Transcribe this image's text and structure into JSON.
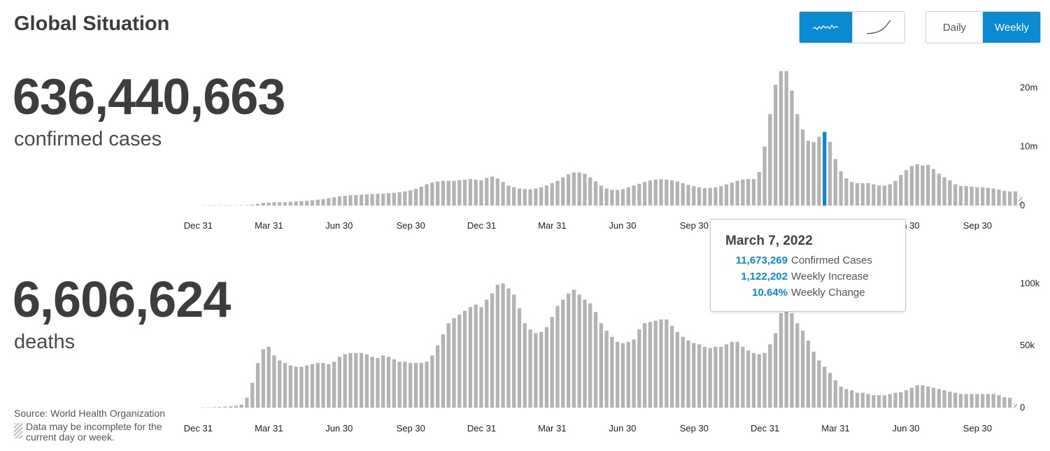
{
  "header": {
    "title": "Global Situation",
    "scale_buttons": [
      {
        "name": "linear-wave-icon",
        "active": true
      },
      {
        "name": "cumulative-curve-icon",
        "active": false
      }
    ],
    "period_buttons": [
      {
        "label": "Daily",
        "active": false
      },
      {
        "label": "Weekly",
        "active": true
      }
    ]
  },
  "cases": {
    "total": "636,440,663",
    "label": "confirmed cases"
  },
  "deaths": {
    "total": "6,606,624",
    "label": "deaths"
  },
  "tooltip": {
    "date": "March 7, 2022",
    "rows": [
      {
        "value": "11,673,269",
        "label": "Confirmed Cases"
      },
      {
        "value": "1,122,202",
        "label": "Weekly Increase"
      },
      {
        "value": "10.64%",
        "label": "Weekly Change"
      }
    ]
  },
  "footer": {
    "source": "Source: World Health Organization",
    "note": "Data may be incomplete for the current day or week."
  },
  "colors": {
    "bar": "#b3b3b3",
    "highlight": "#0a8ad3",
    "accent": "#0a8ad3",
    "text": "#444444"
  },
  "chart_data": [
    {
      "type": "bar",
      "title": "Weekly confirmed cases",
      "ylim": [
        0,
        23000000
      ],
      "y_ticks": [
        {
          "value": 0,
          "label": "0"
        },
        {
          "value": 10000000,
          "label": "10m"
        },
        {
          "value": 20000000,
          "label": "20m"
        }
      ],
      "x_ticks": [
        {
          "index": 1,
          "label": "Dec 31"
        },
        {
          "index": 14,
          "label": "Mar 31"
        },
        {
          "index": 27,
          "label": "Jun 30"
        },
        {
          "index": 40,
          "label": "Sep 30"
        },
        {
          "index": 53,
          "label": "Dec 31"
        },
        {
          "index": 66,
          "label": "Mar 31"
        },
        {
          "index": 79,
          "label": "Jun 30"
        },
        {
          "index": 92,
          "label": "Sep 30"
        },
        {
          "index": 105,
          "label": "Dec 31"
        },
        {
          "index": 118,
          "label": "Mar 31"
        },
        {
          "index": 131,
          "label": "Jun 30"
        },
        {
          "index": 144,
          "label": "Sep 30"
        }
      ],
      "highlight_index": 114,
      "incomplete_last": true,
      "values": [
        0,
        0,
        0,
        0,
        0,
        0,
        0,
        20000,
        70000,
        160000,
        300000,
        450000,
        500000,
        550000,
        570000,
        600000,
        650000,
        700000,
        750000,
        800000,
        900000,
        1000000,
        1100000,
        1250000,
        1400000,
        1550000,
        1650000,
        1750000,
        1800000,
        1850000,
        1900000,
        1950000,
        2000000,
        2050000,
        2100000,
        2150000,
        2250000,
        2400000,
        2600000,
        2850000,
        3200000,
        3600000,
        3900000,
        4100000,
        4200000,
        4200000,
        4200000,
        4300000,
        4400000,
        4500000,
        4400000,
        4300000,
        4700000,
        4900000,
        4600000,
        4000000,
        3400000,
        3100000,
        2900000,
        2800000,
        2750000,
        2900000,
        3100000,
        3400000,
        3800000,
        4200000,
        4800000,
        5300000,
        5600000,
        5600000,
        5400000,
        4800000,
        4100000,
        3400000,
        2900000,
        2650000,
        2650000,
        2800000,
        3100000,
        3400000,
        3700000,
        4000000,
        4250000,
        4400000,
        4450000,
        4400000,
        4300000,
        4100000,
        3800000,
        3500000,
        3300000,
        3100000,
        2950000,
        3000000,
        3100000,
        3300000,
        3600000,
        3900000,
        4200000,
        4400000,
        4500000,
        4500000,
        5700000,
        10000000,
        15500000,
        20500000,
        22800000,
        22800000,
        19500000,
        15500000,
        12900000,
        11000000,
        10800000,
        11673269,
        12500000,
        10800000,
        7900000,
        5800000,
        4600000,
        4000000,
        3800000,
        3800000,
        3800000,
        3600000,
        3400000,
        3400000,
        3600000,
        4200000,
        5200000,
        6000000,
        6700000,
        7000000,
        6800000,
        6900000,
        6200000,
        5400000,
        4800000,
        4300000,
        3600000,
        3300000,
        3300000,
        3200000,
        3100000,
        3100000,
        3000000,
        2900000,
        2700000,
        2500000,
        2400000,
        2400000,
        1600000
      ]
    },
    {
      "type": "bar",
      "title": "Weekly deaths",
      "ylim": [
        0,
        107000
      ],
      "y_ticks": [
        {
          "value": 0,
          "label": "0"
        },
        {
          "value": 50000,
          "label": "50k"
        },
        {
          "value": 100000,
          "label": "100k"
        }
      ],
      "x_ticks": [
        {
          "index": 1,
          "label": "Dec 31"
        },
        {
          "index": 14,
          "label": "Mar 31"
        },
        {
          "index": 27,
          "label": "Jun 30"
        },
        {
          "index": 40,
          "label": "Sep 30"
        },
        {
          "index": 53,
          "label": "Dec 31"
        },
        {
          "index": 66,
          "label": "Mar 31"
        },
        {
          "index": 79,
          "label": "Jun 30"
        },
        {
          "index": 92,
          "label": "Sep 30"
        },
        {
          "index": 105,
          "label": "Dec 31"
        },
        {
          "index": 118,
          "label": "Mar 31"
        },
        {
          "index": 131,
          "label": "Jun 30"
        },
        {
          "index": 144,
          "label": "Sep 30"
        }
      ],
      "incomplete_last": true,
      "values": [
        0,
        0,
        300,
        600,
        800,
        1000,
        1500,
        2500,
        8000,
        20000,
        36000,
        47000,
        49000,
        42000,
        38000,
        36000,
        34000,
        33000,
        33000,
        34000,
        35000,
        36000,
        36000,
        35000,
        37000,
        41000,
        43000,
        44000,
        44000,
        44000,
        43000,
        41000,
        40000,
        42000,
        41000,
        39000,
        37000,
        37000,
        36000,
        36000,
        36000,
        37000,
        42000,
        50000,
        59000,
        68000,
        72000,
        75000,
        78000,
        81000,
        83000,
        81000,
        87000,
        92000,
        99000,
        100000,
        96000,
        91000,
        80000,
        68000,
        63000,
        60000,
        61000,
        65000,
        73000,
        82000,
        87000,
        92000,
        95000,
        91000,
        87000,
        84000,
        77000,
        68000,
        62000,
        57000,
        53000,
        52000,
        53000,
        55000,
        63000,
        68000,
        69000,
        70000,
        71000,
        71000,
        66000,
        61000,
        57000,
        54000,
        52000,
        51000,
        49000,
        48000,
        49000,
        49000,
        51000,
        53000,
        53000,
        49000,
        46000,
        44000,
        43000,
        44000,
        51000,
        60000,
        76000,
        80000,
        76000,
        68000,
        62000,
        54000,
        45000,
        38000,
        33000,
        28000,
        22000,
        17000,
        15000,
        14000,
        12000,
        12000,
        11000,
        10000,
        10000,
        10000,
        11000,
        12000,
        12500,
        14000,
        16000,
        18000,
        18000,
        17000,
        16000,
        15000,
        14000,
        13000,
        12000,
        11000,
        11000,
        11000,
        11000,
        11000,
        11000,
        11000,
        10000,
        8500,
        8000,
        3500
      ]
    }
  ]
}
